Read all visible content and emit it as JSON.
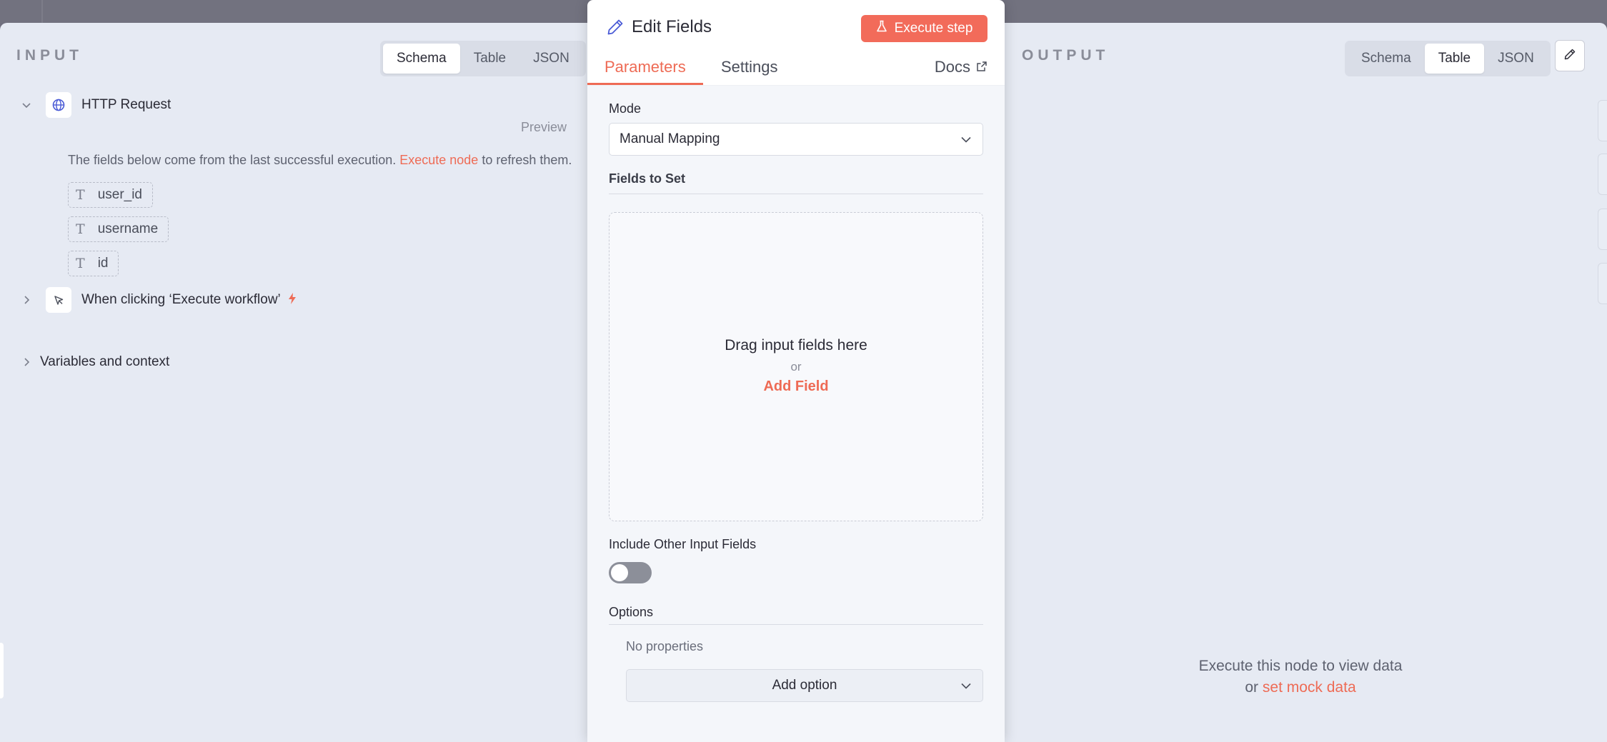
{
  "input_panel": {
    "title": "INPUT",
    "view_tabs": [
      "Schema",
      "Table",
      "JSON"
    ],
    "active_view": "Schema",
    "nodes": [
      {
        "name": "HTTP Request",
        "preview_label": "Preview",
        "info_prefix": "The fields below come from the last successful execution.",
        "info_link": "Execute node",
        "info_suffix": "to refresh them.",
        "fields": [
          "user_id",
          "username",
          "id"
        ],
        "field_type_glyph": "T"
      },
      {
        "name": "When clicking ‘Execute workflow’"
      },
      {
        "name": "Variables and context"
      }
    ]
  },
  "node_panel": {
    "title": "Edit Fields",
    "execute_label": "Execute step",
    "tabs": [
      "Parameters",
      "Settings"
    ],
    "active_tab": "Parameters",
    "docs_label": "Docs",
    "mode_label": "Mode",
    "mode_value": "Manual Mapping",
    "fields_label": "Fields to Set",
    "drop_main": "Drag input fields here",
    "drop_or": "or",
    "add_field": "Add Field",
    "include_label": "Include Other Input Fields",
    "include_enabled": false,
    "options_label": "Options",
    "no_properties": "No properties",
    "add_option": "Add option"
  },
  "output_panel": {
    "title": "OUTPUT",
    "view_tabs": [
      "Schema",
      "Table",
      "JSON"
    ],
    "active_view": "Table",
    "empty_line1": "Execute this node to view data",
    "empty_or": "or",
    "empty_link": "set mock data"
  },
  "colors": {
    "accent": "#ee6b55",
    "execute_button": "#f26b5a",
    "panel_bg": "#e6eaf3",
    "overlay_bg": "#6f6f7e"
  },
  "icons": {
    "http_node": "globe-icon",
    "trigger_node": "cursor-click-icon",
    "edit_fields": "pencil-icon",
    "execute": "flask-icon",
    "docs": "external-link-icon",
    "edit_output": "pencil-icon",
    "trigger_badge": "lightning-icon"
  }
}
